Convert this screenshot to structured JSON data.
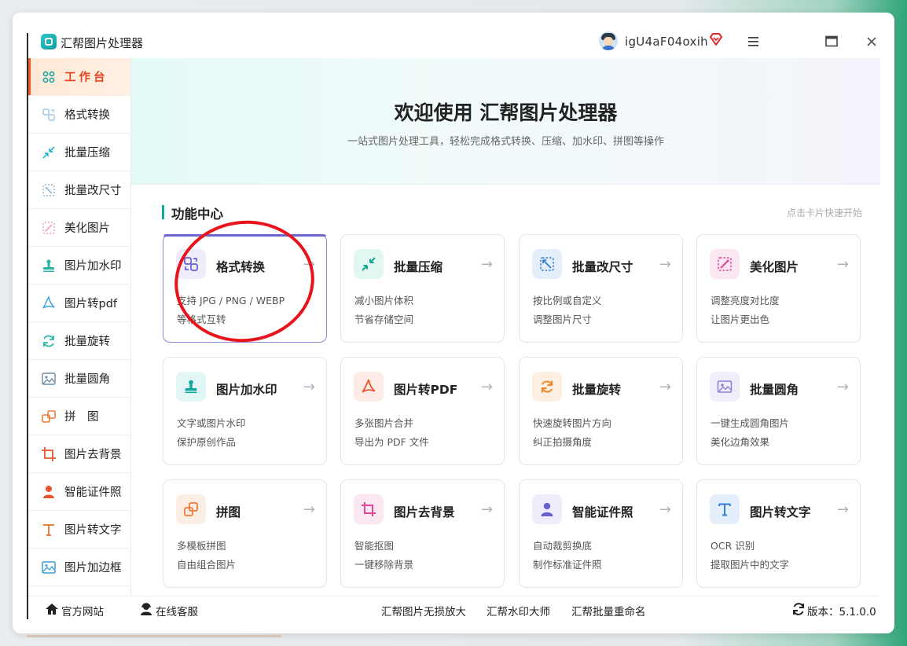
{
  "app": {
    "title": "汇帮图片处理器",
    "username": "igU4aF04oxih"
  },
  "sidebar": {
    "items": [
      {
        "label": "工作台",
        "icon": "dashboard-icon",
        "active": true
      },
      {
        "label": "格式转换",
        "icon": "convert-icon"
      },
      {
        "label": "批量压缩",
        "icon": "compress-icon"
      },
      {
        "label": "批量改尺寸",
        "icon": "resize-icon"
      },
      {
        "label": "美化图片",
        "icon": "beautify-icon"
      },
      {
        "label": "图片加水印",
        "icon": "watermark-icon"
      },
      {
        "label": "图片转pdf",
        "icon": "pdf-icon"
      },
      {
        "label": "批量旋转",
        "icon": "rotate-icon"
      },
      {
        "label": "批量圆角",
        "icon": "round-corner-icon"
      },
      {
        "label": "拼　图",
        "icon": "collage-icon"
      },
      {
        "label": "图片去背景",
        "icon": "crop-icon"
      },
      {
        "label": "智能证件照",
        "icon": "person-icon"
      },
      {
        "label": "图片转文字",
        "icon": "text-icon"
      },
      {
        "label": "图片加边框",
        "icon": "frame-icon"
      }
    ]
  },
  "hero": {
    "title": "欢迎使用 汇帮图片处理器",
    "subtitle": "一站式图片处理工具，轻松完成格式转换、压缩、加水印、拼图等操作"
  },
  "section": {
    "title": "功能中心",
    "hint": "点击卡片快速开始"
  },
  "cards": [
    {
      "title": "格式转换",
      "line1": "支持 JPG / PNG / WEBP",
      "line2": "等格式互转",
      "arrow": "→",
      "icon": "convert-icon",
      "color": "#6a60cf",
      "bg": "#efedfb"
    },
    {
      "title": "批量压缩",
      "line1": "减小图片体积",
      "line2": "节省存储空间",
      "arrow": "→",
      "icon": "compress-icon",
      "color": "#12a88d",
      "bg": "#e3f7f2"
    },
    {
      "title": "批量改尺寸",
      "line1": "按比例或自定义",
      "line2": "调整图片尺寸",
      "arrow": "→",
      "icon": "resize-icon",
      "color": "#2f7fd6",
      "bg": "#e4effb"
    },
    {
      "title": "美化图片",
      "line1": "调整亮度对比度",
      "line2": "让图片更出色",
      "arrow": "→",
      "icon": "beautify-icon",
      "color": "#e0479a",
      "bg": "#fbe7f2"
    },
    {
      "title": "图片加水印",
      "line1": "文字或图片水印",
      "line2": "保护原创作品",
      "arrow": "→",
      "icon": "watermark-icon",
      "color": "#10a89e",
      "bg": "#e2f7f5"
    },
    {
      "title": "图片转PDF",
      "line1": "多张图片合并",
      "line2": "导出为 PDF 文件",
      "arrow": "→",
      "icon": "pdf-icon",
      "color": "#e8552f",
      "bg": "#fdebe5"
    },
    {
      "title": "批量旋转",
      "line1": "快速旋转图片方向",
      "line2": "纠正拍摄角度",
      "arrow": "→",
      "icon": "rotate-icon",
      "color": "#f08a2a",
      "bg": "#fdefe1"
    },
    {
      "title": "批量圆角",
      "line1": "一键生成圆角图片",
      "line2": "美化边角效果",
      "arrow": "→",
      "icon": "round-corner-icon",
      "color": "#8c7fd6",
      "bg": "#f0eefb"
    },
    {
      "title": "拼图",
      "line1": "多模板拼图",
      "line2": "自由组合图片",
      "arrow": "→",
      "icon": "collage-icon",
      "color": "#ee7a3c",
      "bg": "#fdeee4"
    },
    {
      "title": "图片去背景",
      "line1": "智能抠图",
      "line2": "一键移除背景",
      "arrow": "→",
      "icon": "crop-icon",
      "color": "#e0479a",
      "bg": "#fbe7f2"
    },
    {
      "title": "智能证件照",
      "line1": "自动裁剪换底",
      "line2": "制作标准证件照",
      "arrow": "→",
      "icon": "person-icon",
      "color": "#6a60cf",
      "bg": "#efedfb"
    },
    {
      "title": "图片转文字",
      "line1": "OCR 识别",
      "line2": "提取图片中的文字",
      "arrow": "→",
      "icon": "text-icon",
      "color": "#2f7fd6",
      "bg": "#e4effb"
    }
  ],
  "footer": {
    "website": "官方网站",
    "support": "在线客服",
    "link1": "汇帮图片无损放大",
    "link2": "汇帮水印大师",
    "link3": "汇帮批量重命名",
    "version": "版本：5.1.0.0"
  },
  "colors": {
    "accent": "#e8421c",
    "annotation": "#e8141c",
    "selected_card_border": "#6f65d0"
  }
}
